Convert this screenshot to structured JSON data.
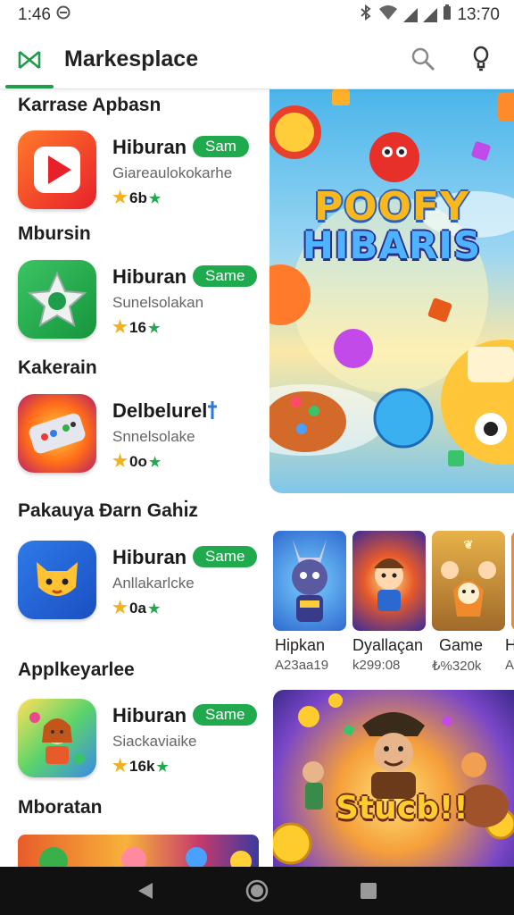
{
  "status_bar": {
    "time": "1:46",
    "clock": "13:70"
  },
  "app_bar": {
    "title": "Markesplace",
    "logo_icon": "marketplace-logo-icon",
    "search_icon": "search-icon",
    "profile_icon": "lightbulb-icon",
    "accent": "#1e9e4a"
  },
  "sections": [
    {
      "title": "Karrase Apbasn",
      "app": {
        "name": "Hiburan",
        "badge": "Sam",
        "sub": "Giareaulokokarhe",
        "rating": "6b",
        "icon": "video-play-icon"
      }
    },
    {
      "title": "Mbursin",
      "app": {
        "name": "Hiburan",
        "badge": "Same",
        "sub": "Sunelsolakan",
        "rating": "16",
        "icon": "star-shape-icon"
      }
    },
    {
      "title": "Kakerain",
      "app": {
        "name": "Delbelurel",
        "badge": "",
        "sub": "Snnelsolake",
        "rating": "0o",
        "icon": "gamepad-icon"
      }
    },
    {
      "title": "Pakauya Ɖarn Gahı̇z",
      "app": {
        "name": "Hiburan",
        "badge": "Same",
        "sub": "Anllakarlcke",
        "rating": "0a",
        "icon": "cat-mascot-icon"
      }
    },
    {
      "title": "Applkeyarlee",
      "app": {
        "name": "Hiburan",
        "badge": "Same",
        "sub": "Siackaviaike",
        "rating": "16k",
        "icon": "puzzle-girl-icon"
      }
    },
    {
      "title": "Mboratan"
    }
  ],
  "hero": {
    "line1": "POOFY",
    "line2": "HIBARIS"
  },
  "thumbs": [
    {
      "name": "Hipkan",
      "meta": "A23aa19"
    },
    {
      "name": "Dyallaçan",
      "meta": "k299:08"
    },
    {
      "name": "Game",
      "meta": "₺%320k"
    },
    {
      "name": "H",
      "meta": "A"
    }
  ],
  "banner2": {
    "title": "Stucb!!"
  },
  "colors": {
    "badge": "#1faa4e",
    "star": "#f3b21b"
  }
}
